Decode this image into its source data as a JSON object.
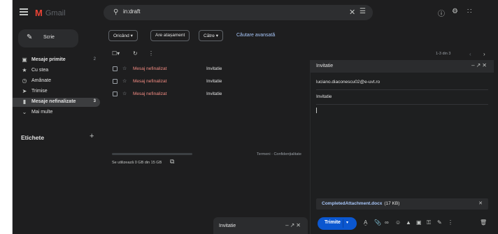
{
  "app": {
    "logo_letter": "M",
    "logo_text": "Gmail"
  },
  "search": {
    "query": "in:draft",
    "placeholder": ""
  },
  "header": {
    "help_icon": "help-icon",
    "settings_icon": "settings-icon",
    "apps_icon": "apps-icon"
  },
  "sidebar": {
    "compose_label": "Scrie",
    "items": [
      {
        "label": "Mesaje primite",
        "count": "2",
        "icon": "inbox-icon"
      },
      {
        "label": "Cu stea",
        "count": "",
        "icon": "star-icon"
      },
      {
        "label": "Amânate",
        "count": "",
        "icon": "clock-icon"
      },
      {
        "label": "Trimise",
        "count": "",
        "icon": "send-icon"
      },
      {
        "label": "Mesaje nefinalizate",
        "count": "3",
        "icon": "draft-icon"
      },
      {
        "label": "Mai multe",
        "count": "",
        "icon": "chevron-down-icon"
      }
    ],
    "labels_title": "Etichete",
    "labels_add": "+"
  },
  "filters": {
    "chips": [
      "Oricând ▾",
      "Are atașament",
      "Către ▾"
    ],
    "advanced": "Căutare avansată"
  },
  "list": {
    "pagination": "1-3 din 3",
    "rows": [
      {
        "sender": "Mesaj nefinalizat",
        "subject": "Invitatie"
      },
      {
        "sender": "Mesaj nefinalizat",
        "subject": "Invitatie"
      },
      {
        "sender": "Mesaj nefinalizat",
        "subject": "Invitatie"
      }
    ],
    "footer_terms": "Termeni · Confidențialitate",
    "storage_text": "Se utilizează 0 GB din 15 GB",
    "storage_used_fraction": 0.0
  },
  "compose_window": {
    "title": "Invitatie",
    "to": "luciano.diaconescu02@e-uvt.ro",
    "subject": "Invitatie",
    "attachment_name": "CompletedAttachment.docx",
    "attachment_size": "(17 KB)",
    "send_label": "Trimite"
  },
  "minimized": {
    "title": "Invitatie"
  },
  "colors": {
    "background": "#1e1e1f",
    "accent": "#0b57d0",
    "draft_red": "#f28b82",
    "link": "#a8c7fa"
  }
}
